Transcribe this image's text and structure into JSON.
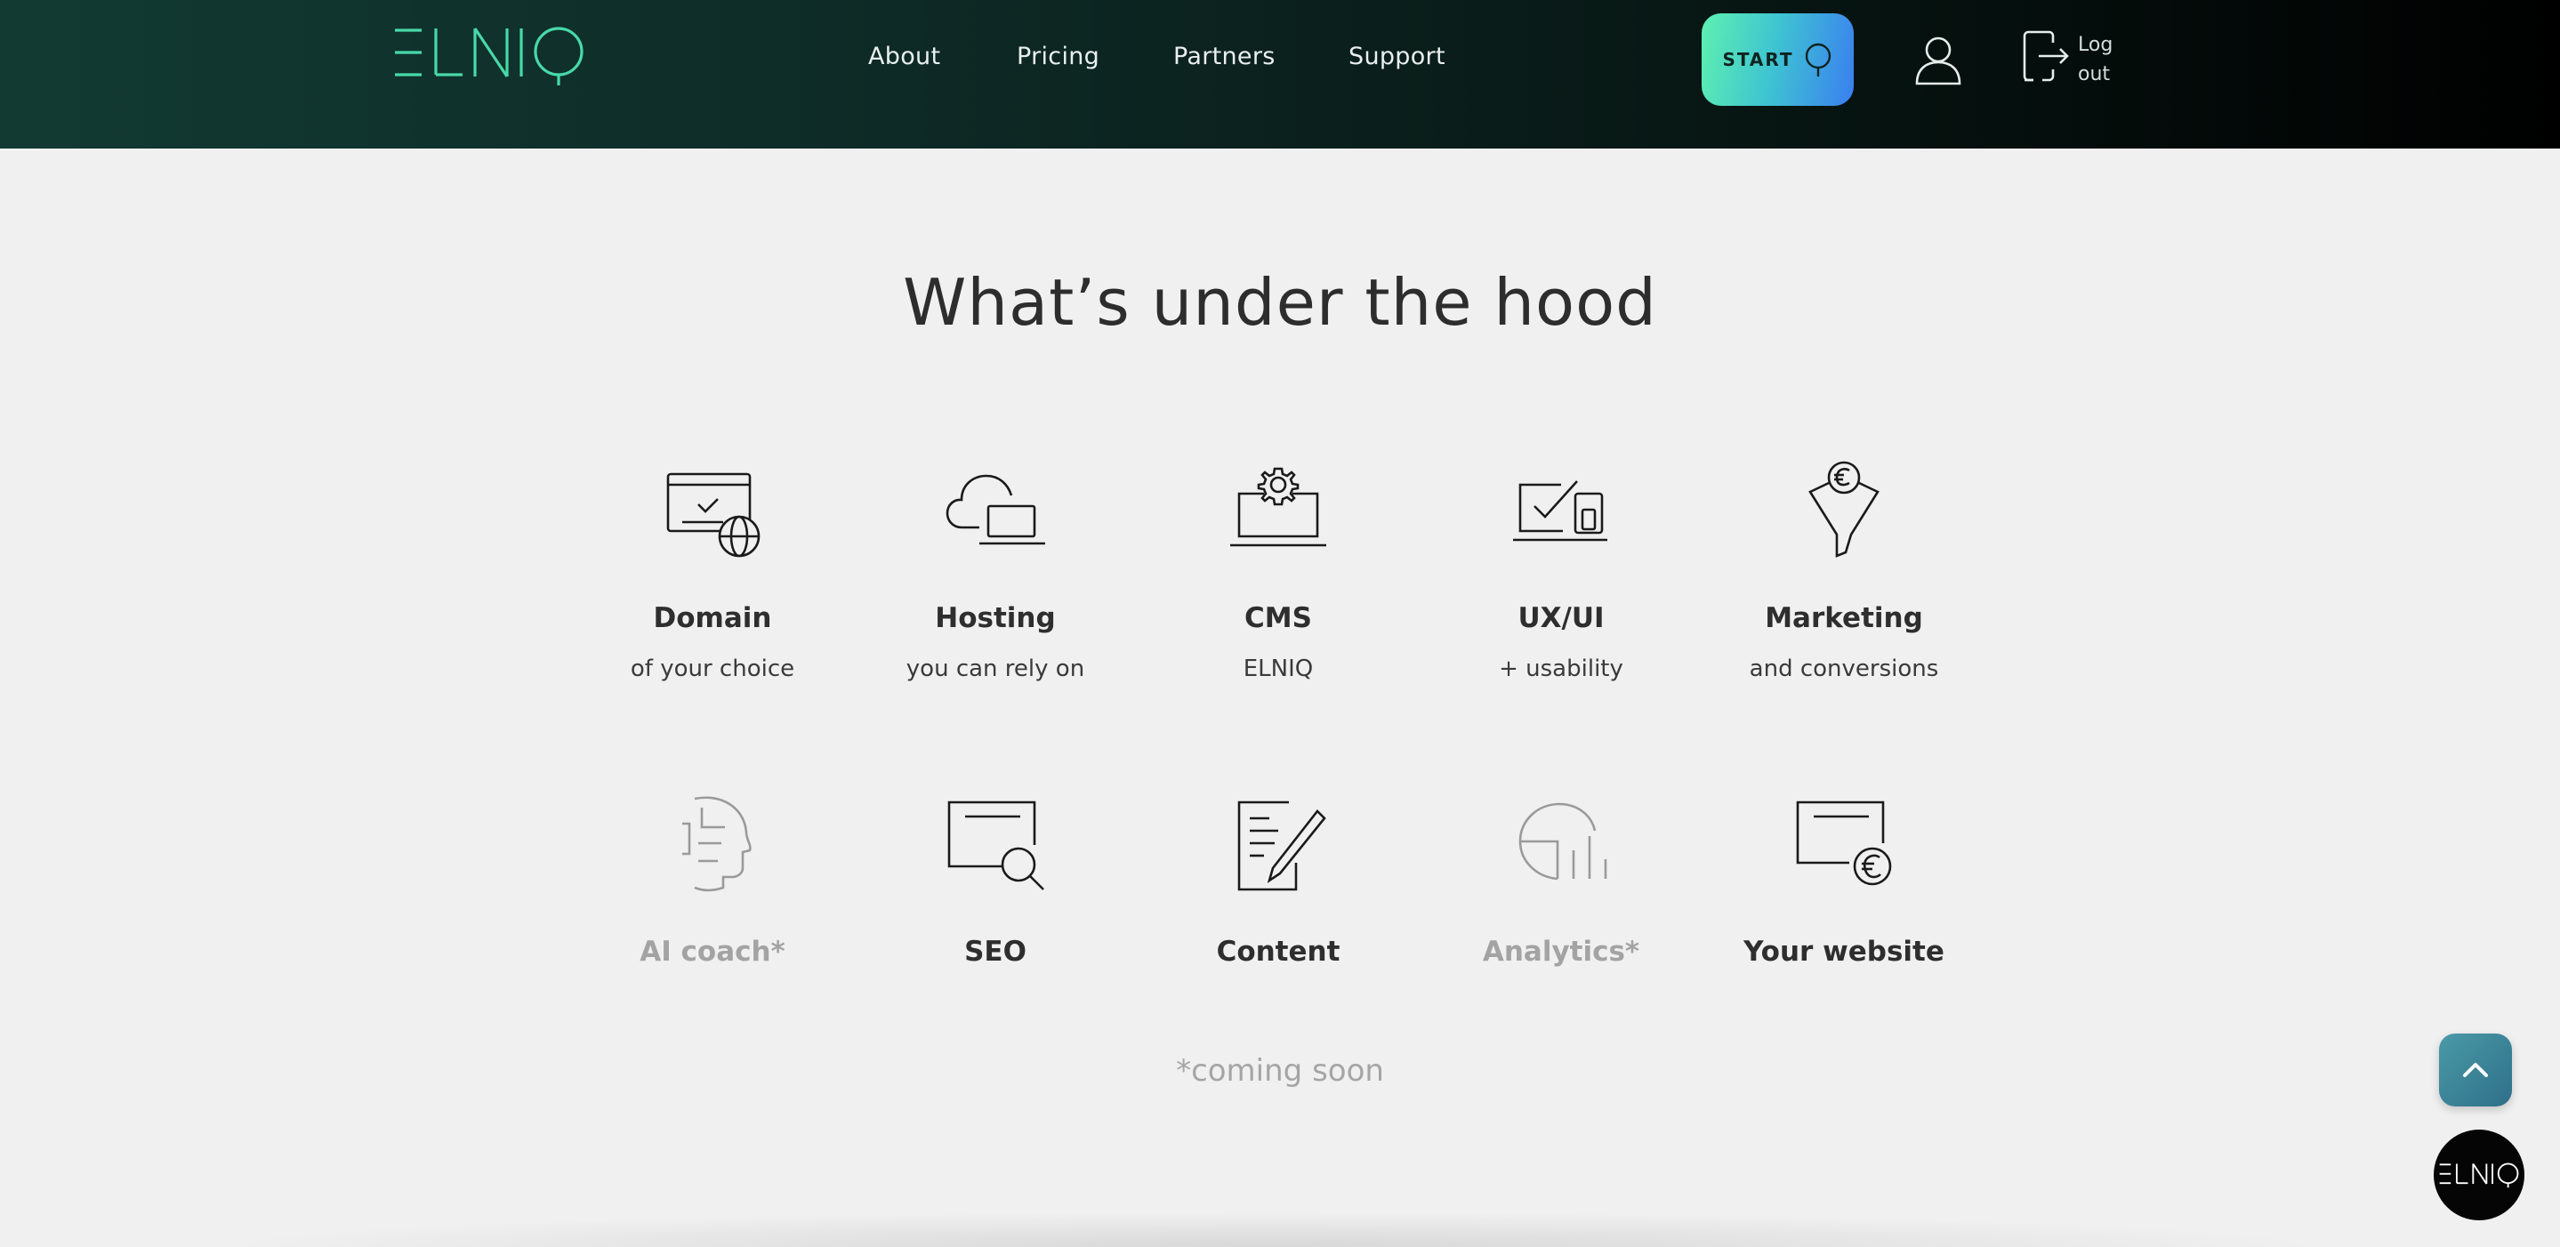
{
  "header": {
    "logo_text": "ELNIQ",
    "nav": [
      {
        "label": "About"
      },
      {
        "label": "Pricing"
      },
      {
        "label": "Partners"
      },
      {
        "label": "Support"
      }
    ],
    "start_label": "START",
    "logout_line1": "Log",
    "logout_line2": "out"
  },
  "main": {
    "title": "What’s under the hood",
    "features": [
      {
        "name": "Domain",
        "sub": "of your choice",
        "icon": "domain-icon"
      },
      {
        "name": "Hosting",
        "sub": "you can rely on",
        "icon": "cloud-laptop-icon"
      },
      {
        "name": "CMS",
        "sub": "ELNIQ",
        "icon": "laptop-gear-icon"
      },
      {
        "name": "UX/UI",
        "sub": "+ usability",
        "icon": "devices-check-icon"
      },
      {
        "name": "Marketing",
        "sub": "and conversions",
        "icon": "funnel-euro-icon"
      },
      {
        "name": "AI coach*",
        "icon": "ai-head-icon",
        "coming_soon": true
      },
      {
        "name": "SEO",
        "icon": "browser-search-icon"
      },
      {
        "name": "Content",
        "icon": "document-pen-icon"
      },
      {
        "name": "Analytics*",
        "icon": "analytics-chart-icon",
        "coming_soon": true
      },
      {
        "name": "Your website",
        "icon": "browser-euro-icon"
      }
    ],
    "footnote": "*coming soon"
  },
  "colors": {
    "accent_green": "#5ef0b0",
    "accent_blue": "#3a7ff0",
    "header_dark": "#0e2a26",
    "muted_text": "#a3a3a3"
  },
  "widgets": {
    "scroll_top_icon": "chevron-up-icon",
    "chat_logo_text": "ELNIQ"
  }
}
